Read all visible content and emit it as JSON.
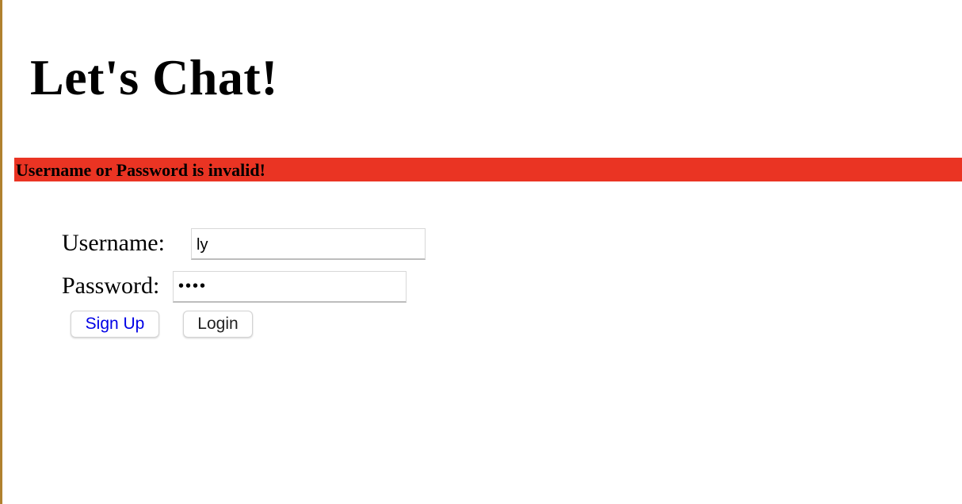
{
  "header": {
    "title": "Let's Chat!"
  },
  "error": {
    "message": "Username or Password is invalid!",
    "background_color": "#ea3423"
  },
  "login_form": {
    "username_label": "Username:",
    "username_value": "ly",
    "password_label": "Password:",
    "password_value": "••••",
    "signup_label": "Sign Up",
    "login_label": "Login"
  },
  "colors": {
    "link_blue": "#0000e6"
  }
}
